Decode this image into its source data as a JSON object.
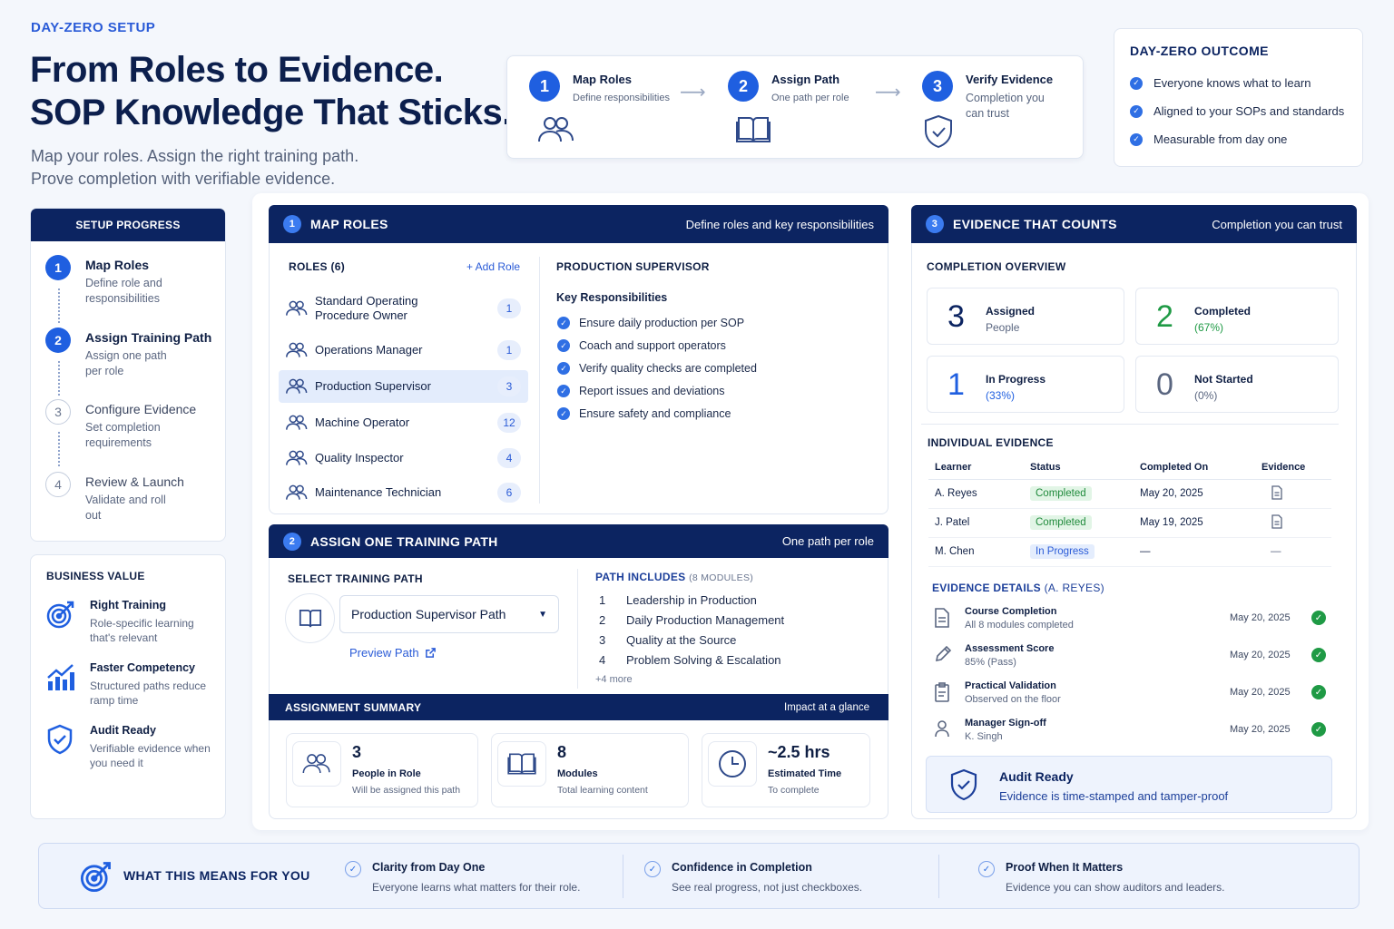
{
  "hero": {
    "eyebrow": "DAY-ZERO SETUP",
    "title_line1": "From Roles to Evidence.",
    "title_line2": "SOP Knowledge That Sticks.",
    "sub_line1": "Map your roles. Assign the right training path.",
    "sub_line2": "Prove completion with verifiable evidence."
  },
  "flow": [
    {
      "num": "1",
      "title": "Map Roles",
      "sub": "Define responsibilities",
      "icon": "people-icon"
    },
    {
      "num": "2",
      "title": "Assign Path",
      "sub": "One path per role",
      "icon": "book-icon"
    },
    {
      "num": "3",
      "title": "Verify Evidence",
      "sub": "Completion you can trust",
      "sub1": "Completion you",
      "sub2": "can trust",
      "icon": "shield-check-icon"
    }
  ],
  "outcome": {
    "title": "DAY-ZERO OUTCOME",
    "items": [
      "Everyone knows what to learn",
      "Aligned to your SOPs and standards",
      "Measurable from day one"
    ]
  },
  "progress": {
    "title": "SETUP PROGRESS",
    "steps": [
      {
        "num": "1",
        "title": "Map Roles",
        "desc": "Define role and responsibilities",
        "active": true
      },
      {
        "num": "2",
        "title": "Assign Training Path",
        "desc": "Assign one path per role",
        "active": true
      },
      {
        "num": "3",
        "title": "Configure Evidence",
        "desc": "Set completion requirements",
        "active": false
      },
      {
        "num": "4",
        "title": "Review & Launch",
        "desc": "Validate and roll out",
        "active": false
      }
    ]
  },
  "business_value": {
    "title": "BUSINESS VALUE",
    "items": [
      {
        "title": "Right Training",
        "desc": "Role-specific learning that's relevant",
        "icon": "target-icon"
      },
      {
        "title": "Faster Competency",
        "desc": "Structured paths reduce ramp time",
        "icon": "growth-chart-icon"
      },
      {
        "title": "Audit Ready",
        "desc": "Verifiable evidence when you need it",
        "icon": "shield-check-icon"
      }
    ]
  },
  "map_roles": {
    "num": "1",
    "title": "MAP ROLES",
    "subtitle": "Define roles and key responsibilities",
    "roles_label": "ROLES (6)",
    "add_role": "+ Add Role",
    "roles": [
      {
        "name": "Standard Operating Procedure Owner",
        "count": "1",
        "selected": false
      },
      {
        "name": "Operations Manager",
        "count": "1",
        "selected": false
      },
      {
        "name": "Production Supervisor",
        "count": "3",
        "selected": true
      },
      {
        "name": "Machine Operator",
        "count": "12",
        "selected": false
      },
      {
        "name": "Quality Inspector",
        "count": "4",
        "selected": false
      },
      {
        "name": "Maintenance Technician",
        "count": "6",
        "selected": false
      }
    ],
    "detail_title": "PRODUCTION SUPERVISOR",
    "resp_title": "Key Responsibilities",
    "responsibilities": [
      "Ensure daily production per SOP",
      "Coach and support operators",
      "Verify quality checks are completed",
      "Report issues and deviations",
      "Ensure safety and compliance"
    ]
  },
  "assign_path": {
    "num": "2",
    "title": "ASSIGN ONE TRAINING PATH",
    "subtitle": "One path per role",
    "select_label": "SELECT TRAINING PATH",
    "selected_path": "Production Supervisor Path",
    "preview": "Preview Path",
    "includes_label": "PATH INCLUDES",
    "includes_count": "(8 MODULES)",
    "modules": [
      {
        "n": "1",
        "name": "Leadership in Production"
      },
      {
        "n": "2",
        "name": "Daily Production Management"
      },
      {
        "n": "3",
        "name": "Quality at the Source"
      },
      {
        "n": "4",
        "name": "Problem Solving & Escalation"
      }
    ],
    "more": "+4 more",
    "summary_title": "ASSIGNMENT SUMMARY",
    "summary_sub": "Impact at a glance",
    "stats": [
      {
        "value": "3",
        "title": "People in Role",
        "desc": "Will be assigned this path",
        "icon": "people-icon"
      },
      {
        "value": "8",
        "title": "Modules",
        "desc": "Total learning content",
        "icon": "book-icon"
      },
      {
        "value": "~2.5 hrs",
        "title": "Estimated Time",
        "desc": "To complete",
        "icon": "clock-icon"
      }
    ]
  },
  "evidence": {
    "num": "3",
    "title": "EVIDENCE THAT COUNTS",
    "subtitle": "Completion you can trust",
    "overview_label": "COMPLETION OVERVIEW",
    "overview": [
      {
        "value": "3",
        "title": "Assigned",
        "desc": "People",
        "color": "#0c2461",
        "desc_color": "#5a6680"
      },
      {
        "value": "2",
        "title": "Completed",
        "desc": "(67%)",
        "color": "#1f9a45",
        "desc_color": "#1f9a45"
      },
      {
        "value": "1",
        "title": "In Progress",
        "desc": "(33%)",
        "color": "#1f5fe0",
        "desc_color": "#1f5fe0"
      },
      {
        "value": "0",
        "title": "Not Started",
        "desc": "(0%)",
        "color": "#5a6680",
        "desc_color": "#5a6680"
      }
    ],
    "individual_label": "INDIVIDUAL EVIDENCE",
    "columns": [
      "Learner",
      "Status",
      "Completed On",
      "Evidence"
    ],
    "rows": [
      {
        "learner": "A. Reyes",
        "status": "Completed",
        "date": "May 20, 2025",
        "evidence": "doc"
      },
      {
        "learner": "J. Patel",
        "status": "Completed",
        "date": "May 19, 2025",
        "evidence": "doc"
      },
      {
        "learner": "M. Chen",
        "status": "In Progress",
        "date": "—",
        "evidence": "—"
      }
    ],
    "details_label": "EVIDENCE DETAILS",
    "details_who": "(A. REYES)",
    "details": [
      {
        "title": "Course Completion",
        "desc": "All 8 modules completed",
        "date": "May 20, 2025",
        "icon": "document-icon"
      },
      {
        "title": "Assessment Score",
        "desc": "85% (Pass)",
        "date": "May 20, 2025",
        "icon": "pencil-icon"
      },
      {
        "title": "Practical Validation",
        "desc": "Observed on the floor",
        "date": "May 20, 2025",
        "icon": "clipboard-icon"
      },
      {
        "title": "Manager Sign-off",
        "desc": "K. Singh",
        "date": "May 20, 2025",
        "icon": "person-icon"
      }
    ],
    "audit_title": "Audit Ready",
    "audit_desc": "Evidence is time-stamped and tamper-proof"
  },
  "bottom": {
    "title": "WHAT THIS MEANS FOR YOU",
    "items": [
      {
        "title": "Clarity from Day One",
        "desc": "Everyone learns what matters for their role."
      },
      {
        "title": "Confidence in Completion",
        "desc": "See real progress, not just checkboxes."
      },
      {
        "title": "Proof When It Matters",
        "desc": "Evidence you can show auditors and leaders."
      }
    ]
  }
}
